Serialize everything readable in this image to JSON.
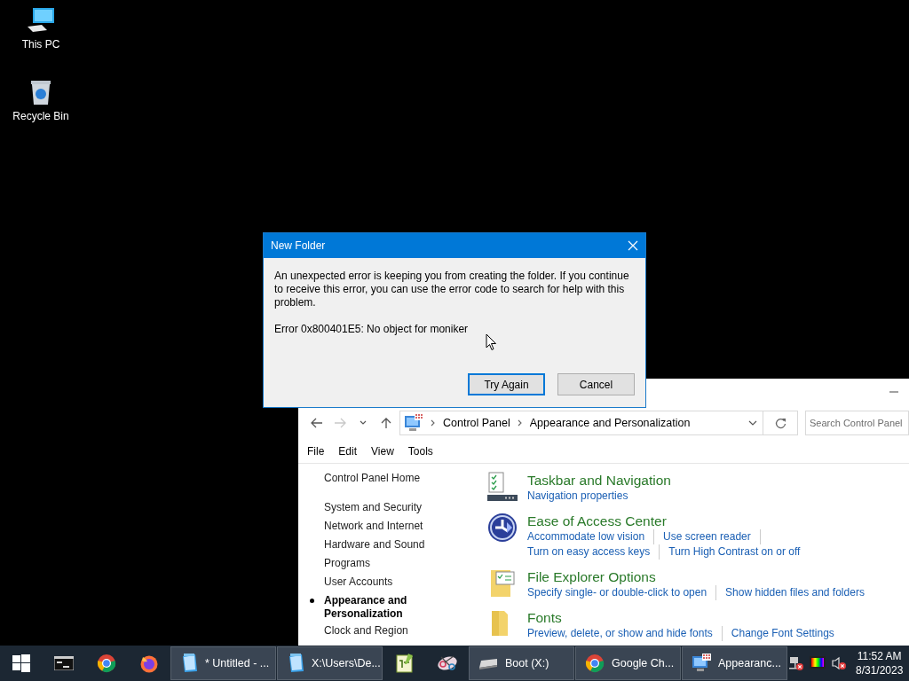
{
  "desktop_icons": [
    {
      "kind": "computer",
      "label": "This PC"
    },
    {
      "kind": "recycle-bin",
      "label": "Recycle Bin"
    }
  ],
  "dialog": {
    "title": "New Folder",
    "message": "An unexpected error is keeping you from creating the folder. If you continue to receive this error, you can use the error code to search for help with this problem.",
    "error": "Error 0x800401E5: No object for moniker",
    "buttons": [
      {
        "label": "Try Again",
        "default": true
      },
      {
        "label": "Cancel",
        "default": false
      }
    ]
  },
  "control_panel": {
    "breadcrumb": [
      "Control Panel",
      "Appearance and Personalization"
    ],
    "search": {
      "placeholder": "Search Control Panel"
    },
    "menu": [
      "File",
      "Edit",
      "View",
      "Tools"
    ],
    "nav": [
      {
        "label": "Control Panel Home",
        "selected": false
      },
      {
        "label": "System and Security",
        "selected": false
      },
      {
        "label": "Network and Internet",
        "selected": false
      },
      {
        "label": "Hardware and Sound",
        "selected": false
      },
      {
        "label": "Programs",
        "selected": false
      },
      {
        "label": "User Accounts",
        "selected": false
      },
      {
        "label": "Appearance and Personalization",
        "selected": true
      },
      {
        "label": "Clock and Region",
        "selected": false
      }
    ],
    "categories": [
      {
        "kind": "taskbar",
        "title": "Taskbar and Navigation",
        "links": [
          "Navigation properties"
        ]
      },
      {
        "kind": "ease-of-access",
        "title": "Ease of Access Center",
        "links": [
          "Accommodate low vision",
          "Use screen reader",
          "Turn on easy access keys",
          "Turn High Contrast on or off"
        ]
      },
      {
        "kind": "folder-options",
        "title": "File Explorer Options",
        "links": [
          "Specify single- or double-click to open",
          "Show hidden files and folders"
        ]
      },
      {
        "kind": "fonts",
        "title": "Fonts",
        "links": [
          "Preview, delete, or show and hide fonts",
          "Change Font Settings"
        ]
      }
    ]
  },
  "taskbar": {
    "items": [
      {
        "kind": "start",
        "open": false
      },
      {
        "kind": "terminal",
        "open": false
      },
      {
        "kind": "chrome",
        "open": false
      },
      {
        "kind": "firefox",
        "open": false
      },
      {
        "kind": "notepad",
        "label": "* Untitled - ...",
        "open": true
      },
      {
        "kind": "notepad",
        "label": "X:\\Users\\De...",
        "open": true
      },
      {
        "kind": "editor",
        "open": false
      },
      {
        "kind": "snip",
        "open": false
      },
      {
        "kind": "drive",
        "label": "Boot (X:)",
        "open": true
      },
      {
        "kind": "chrome",
        "label": "Google Ch...",
        "open": true
      },
      {
        "kind": "control-panel",
        "label": "Appearanc...",
        "open": true
      }
    ],
    "clock": {
      "time": "11:52 AM",
      "date": "8/31/2023"
    }
  }
}
